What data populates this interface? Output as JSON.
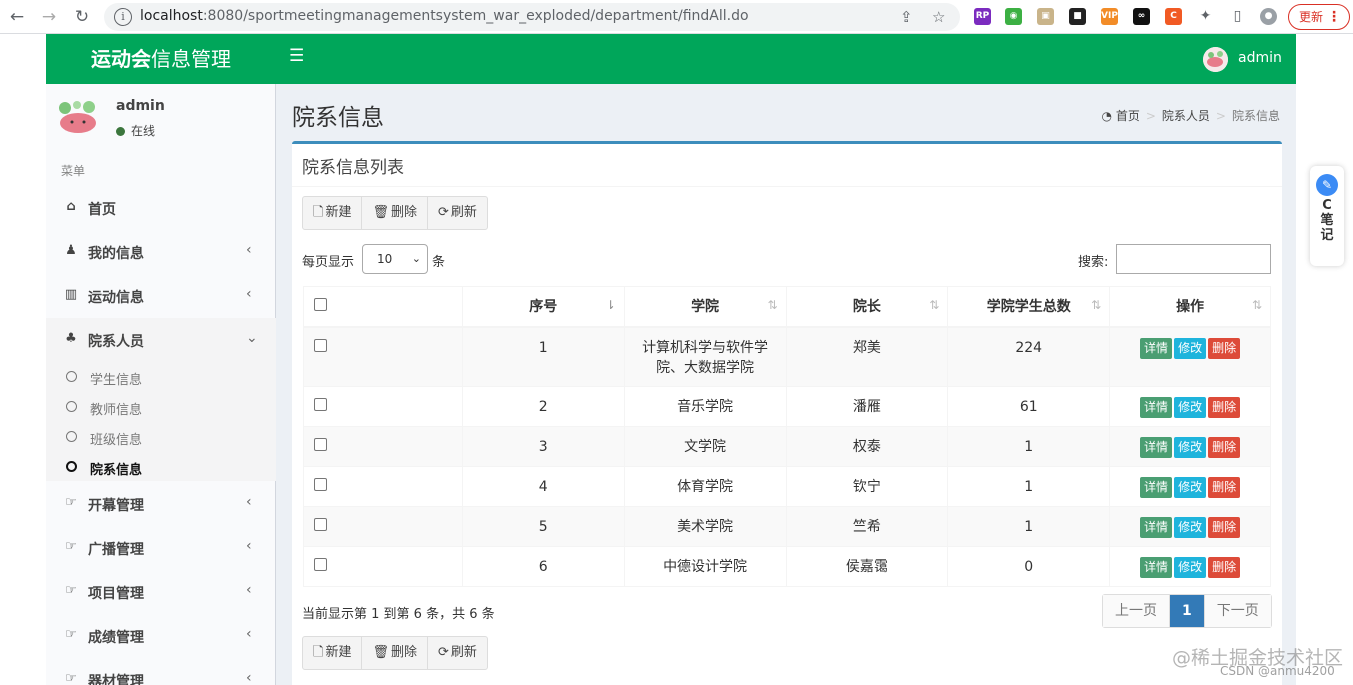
{
  "browser": {
    "url_host": "localhost",
    "url_rest": ":8080/sportmeetingmanagementsystem_war_exploded/department/findAll.do",
    "update_label": "更新"
  },
  "header": {
    "logo_bold": "运动会",
    "logo_rest": "信息管理",
    "user": "admin"
  },
  "sidebar": {
    "user": "admin",
    "status": "在线",
    "menu_header": "菜单",
    "items": [
      {
        "label": "首页",
        "icon": "home-icon"
      },
      {
        "label": "我的信息",
        "icon": "user-icon"
      },
      {
        "label": "运动信息",
        "icon": "bar-chart-icon"
      },
      {
        "label": "院系人员",
        "icon": "users-icon"
      },
      {
        "label": "开幕管理",
        "icon": "hand-point-icon"
      },
      {
        "label": "广播管理",
        "icon": "hand-point-icon"
      },
      {
        "label": "项目管理",
        "icon": "hand-point-icon"
      },
      {
        "label": "成绩管理",
        "icon": "hand-point-icon"
      },
      {
        "label": "器材管理",
        "icon": "hand-point-icon"
      }
    ],
    "submenu": [
      "学生信息",
      "教师信息",
      "班级信息",
      "院系信息"
    ]
  },
  "page": {
    "title": "院系信息",
    "breadcrumb": [
      "首页",
      "院系人员",
      "院系信息"
    ]
  },
  "box": {
    "title": "院系信息列表",
    "toolbar": {
      "new": "新建",
      "delete": "删除",
      "refresh": "刷新"
    },
    "length_label": "每页显示",
    "length_value": "10",
    "length_unit": "条",
    "search_label": "搜索:",
    "columns": [
      "序号",
      "学院",
      "院长",
      "学院学生总数",
      "操作"
    ],
    "rows": [
      {
        "id": "1",
        "college": "计算机科学与软件学院、大数据学院",
        "dean": "郑美",
        "total": "224"
      },
      {
        "id": "2",
        "college": "音乐学院",
        "dean": "潘雁",
        "total": "61"
      },
      {
        "id": "3",
        "college": "文学院",
        "dean": "权泰",
        "total": "1"
      },
      {
        "id": "4",
        "college": "体育学院",
        "dean": "钦宁",
        "total": "1"
      },
      {
        "id": "5",
        "college": "美术学院",
        "dean": "竺希",
        "total": "1"
      },
      {
        "id": "6",
        "college": "中德设计学院",
        "dean": "侯嘉霭",
        "total": "0"
      }
    ],
    "actions": {
      "detail": "详情",
      "edit": "修改",
      "delete": "删除"
    },
    "info": "当前显示第 1 到第 6 条，共 6 条",
    "pager": {
      "prev": "上一页",
      "current": "1",
      "next": "下一页"
    }
  },
  "widgets": {
    "note_text": "C\n笔\n记",
    "watermark": "@稀土掘金技术社区",
    "watermark2": "CSDN @anmu4200"
  },
  "colors": {
    "header": "#00a65a",
    "box_accent": "#3c8dbc",
    "detail": "#4a9e72",
    "edit": "#1eb4dc",
    "delete": "#dd4b39"
  }
}
